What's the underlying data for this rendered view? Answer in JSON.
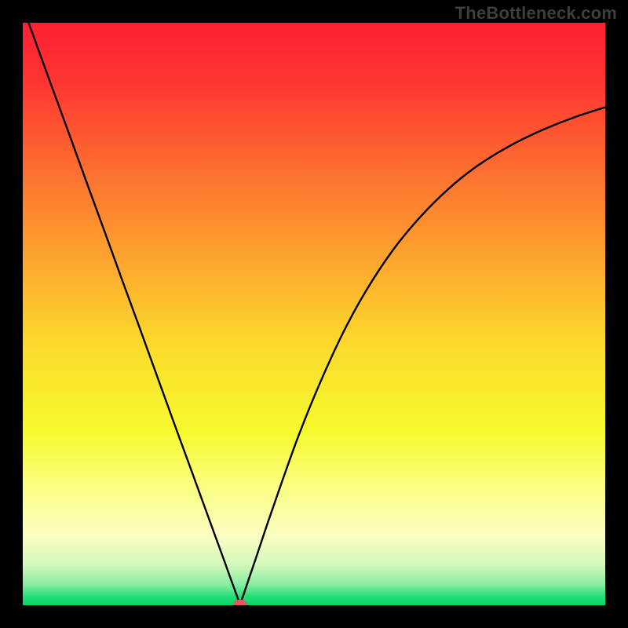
{
  "watermark": "TheBottleneck.com",
  "chart_data": {
    "type": "line",
    "title": "",
    "xlabel": "",
    "ylabel": "",
    "xlim": [
      0,
      100
    ],
    "ylim": [
      0,
      100
    ],
    "legend": null,
    "background": {
      "type": "vertical-gradient",
      "stops": [
        {
          "offset": 0.0,
          "color": "#fe2033"
        },
        {
          "offset": 0.1,
          "color": "#fe3532"
        },
        {
          "offset": 0.25,
          "color": "#fd6d30"
        },
        {
          "offset": 0.4,
          "color": "#fda32e"
        },
        {
          "offset": 0.55,
          "color": "#fcd92c"
        },
        {
          "offset": 0.7,
          "color": "#f6fa2d"
        },
        {
          "offset": 0.8,
          "color": "#fbfe84"
        },
        {
          "offset": 0.88,
          "color": "#fbfdc1"
        },
        {
          "offset": 0.93,
          "color": "#d4f9bd"
        },
        {
          "offset": 0.965,
          "color": "#86eda0"
        },
        {
          "offset": 0.985,
          "color": "#25de77"
        },
        {
          "offset": 1.0,
          "color": "#02d566"
        }
      ]
    },
    "series": [
      {
        "name": "bottleneck-curve",
        "color": "#000000",
        "x": [
          1.0,
          3,
          5,
          8,
          11,
          14,
          17,
          20,
          23,
          26,
          29,
          31,
          33,
          34.5,
          35.5,
          36.3,
          36.8,
          37.3,
          37.3,
          37.9,
          38.7,
          40,
          42,
          44.5,
          47.5,
          51,
          55,
          59,
          63.5,
          68,
          73,
          78,
          83.5,
          89,
          94.5,
          100
        ],
        "y": [
          100,
          94.5,
          89,
          80.8,
          72.5,
          64.3,
          56,
          47.8,
          39.5,
          31.2,
          23,
          17.5,
          12,
          7.9,
          5.1,
          2.9,
          1.5,
          0.2,
          0.2,
          1.8,
          4.2,
          8,
          14,
          21.2,
          29.5,
          38.1,
          46.8,
          54.1,
          60.9,
          66.4,
          71.4,
          75.4,
          78.8,
          81.5,
          83.7,
          85.5
        ]
      }
    ],
    "marker": {
      "name": "optimal-point",
      "x": 37.3,
      "y": 0.2,
      "color": "#e05a5f",
      "rx": 1.2,
      "ry": 0.8
    }
  },
  "colors": {
    "frame": "#000000",
    "curve": "#000000",
    "marker": "#e05a5f"
  }
}
